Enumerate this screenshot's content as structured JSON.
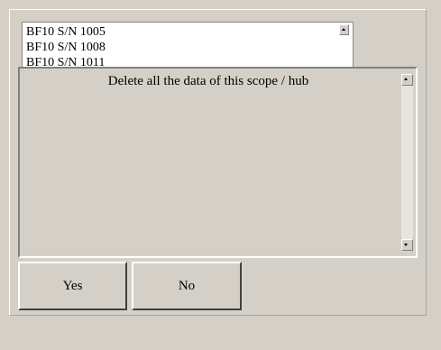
{
  "device_list": {
    "items": [
      "BF10 S/N 1005",
      "BF10 S/N 1008",
      "BF10 S/N 1011"
    ]
  },
  "dialog": {
    "message": "Delete all the data of this scope / hub",
    "yes_label": "Yes",
    "no_label": "No"
  },
  "icons": {
    "scroll_up": "scroll-up-arrow-icon",
    "scroll_down": "scroll-down-arrow-icon"
  },
  "colors": {
    "window_background": "#d4d0c8",
    "list_background": "#ffffff",
    "text": "#000000"
  }
}
